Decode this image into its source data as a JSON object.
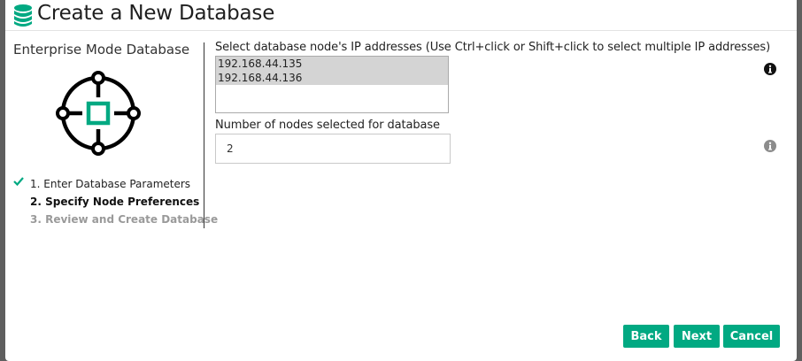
{
  "header": {
    "title": "Create a New Database",
    "icon": "database-icon"
  },
  "left_panel": {
    "mode_label": "Enterprise Mode Database",
    "mode_icon": "crosshair-target-icon",
    "steps": [
      {
        "label": "1. Enter Database Parameters",
        "state": "done"
      },
      {
        "label": "2. Specify Node Preferences",
        "state": "active"
      },
      {
        "label": "3. Review and Create Database",
        "state": "pending"
      }
    ]
  },
  "ip_section": {
    "label": "Select database node's IP addresses (Use Ctrl+click or Shift+click to select multiple IP addresses)",
    "options": [
      "192.168.44.135",
      "192.168.44.136"
    ]
  },
  "nodes_section": {
    "label": "Number of nodes selected for database",
    "value": "2"
  },
  "buttons": {
    "back": "Back",
    "next": "Next",
    "cancel": "Cancel"
  },
  "colors": {
    "accent": "#01a982",
    "selection": "#d4d4d4",
    "pending_text": "#9a9a9a"
  }
}
